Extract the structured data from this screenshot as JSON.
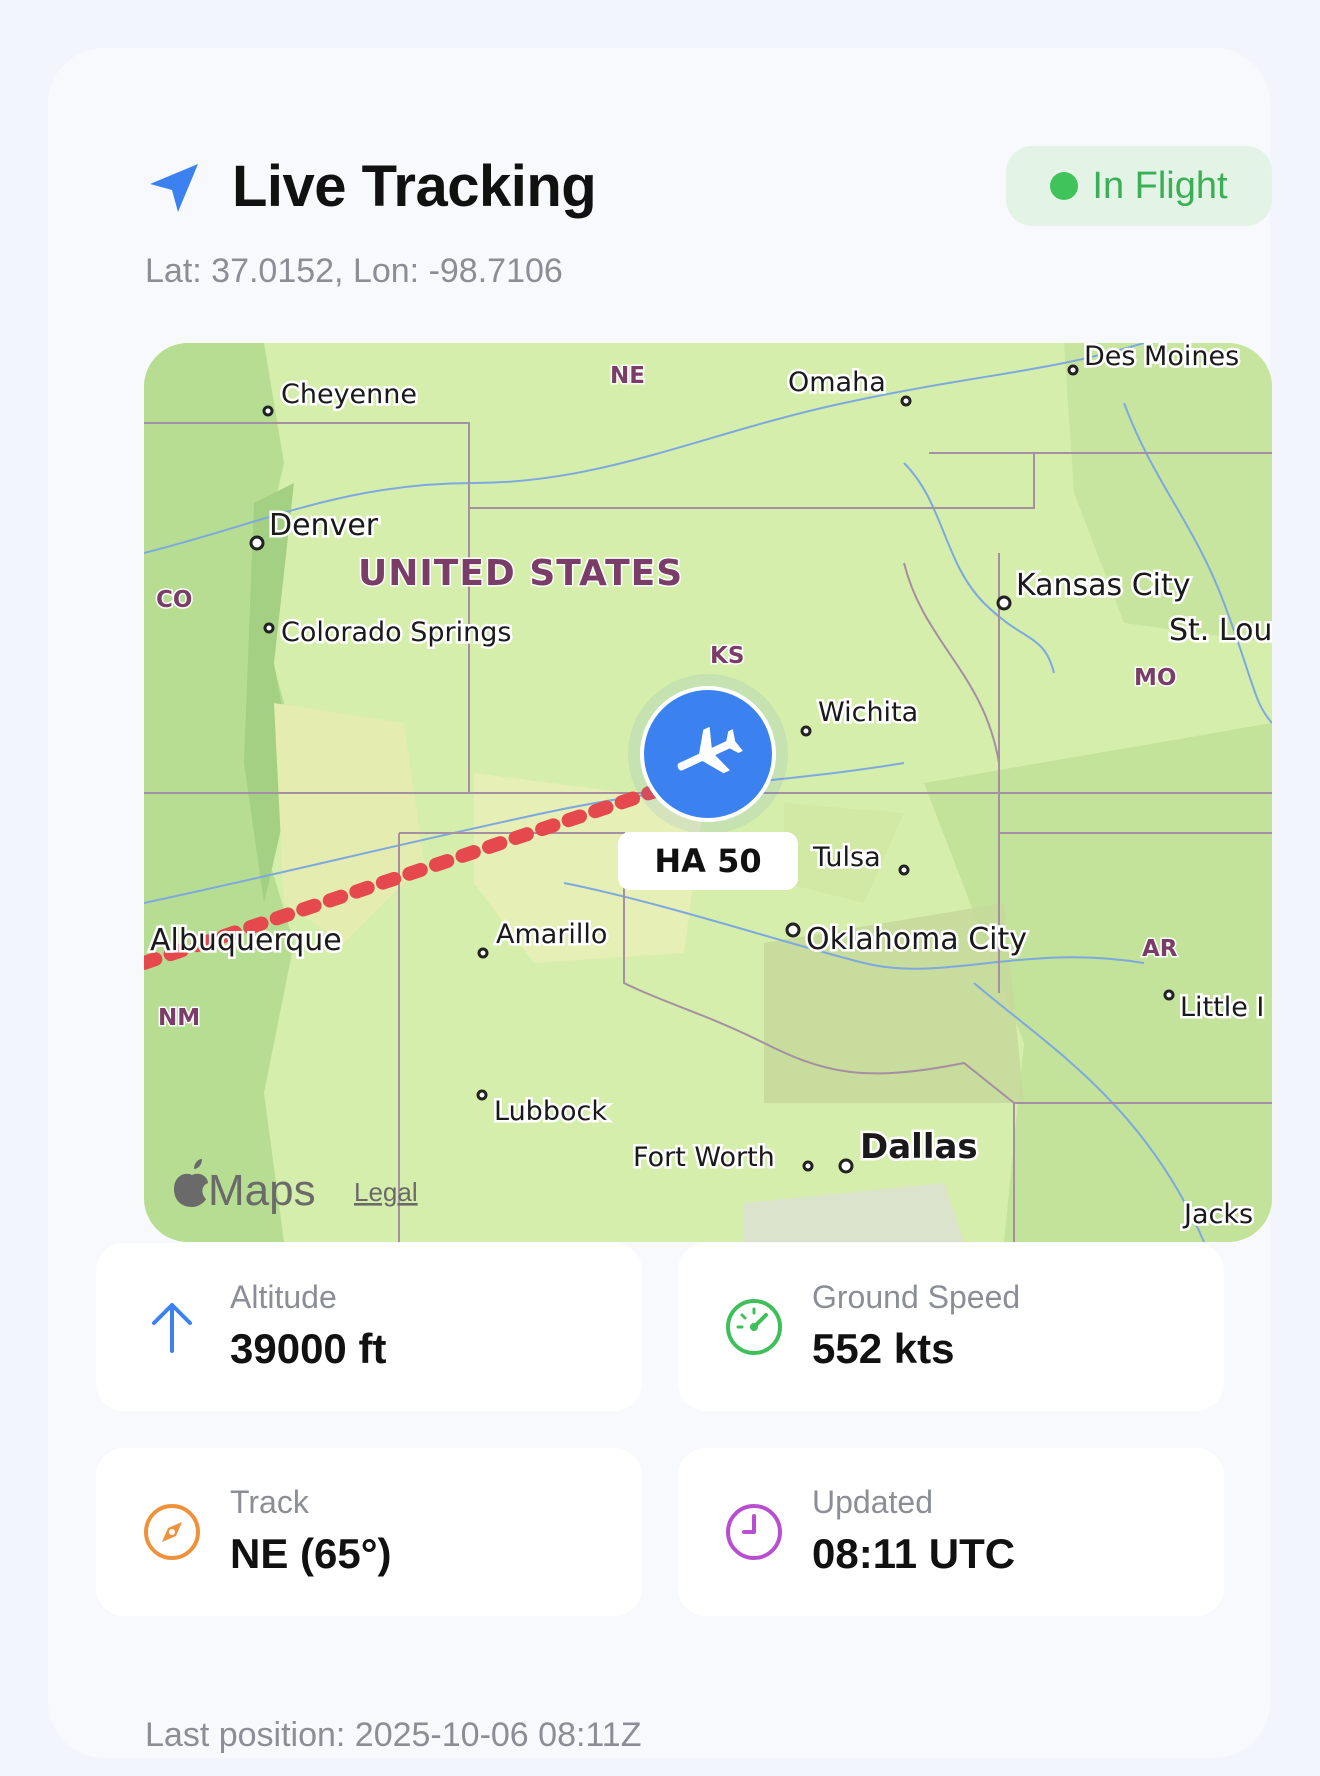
{
  "header": {
    "title": "Live Tracking",
    "icon": "navigation-arrow-icon",
    "status": "In Flight",
    "status_color": "#3fc35a",
    "coordinates": "Lat: 37.0152, Lon: -98.7106"
  },
  "map": {
    "flight_label": "HA 50",
    "cities": {
      "cheyenne": "Cheyenne",
      "denver": "Denver",
      "colorado_springs": "Colorado Springs",
      "omaha": "Omaha",
      "des_moines": "Des Moines",
      "kansas_city": "Kansas City",
      "st_louis": "St. Lou",
      "wichita": "Wichita",
      "tulsa": "Tulsa",
      "oklahoma_city": "Oklahoma City",
      "albuquerque": "Albuquerque",
      "amarillo": "Amarillo",
      "lubbock": "Lubbock",
      "fort_worth": "Fort Worth",
      "dallas": "Dallas",
      "little_rock": "Little I",
      "jackson": "Jacks"
    },
    "states": {
      "ne": "NE",
      "co": "CO",
      "ks": "KS",
      "mo": "MO",
      "ar": "AR",
      "nm": "NM"
    },
    "country": "UNITED STATES",
    "attribution": "Maps",
    "legal": "Legal",
    "route_color": "#e5484d",
    "marker_color": "#3b82f0"
  },
  "stats": {
    "altitude": {
      "label": "Altitude",
      "value": "39000 ft",
      "icon": "arrow-up-icon",
      "color": "#3b82f0"
    },
    "ground_speed": {
      "label": "Ground Speed",
      "value": "552 kts",
      "icon": "speedometer-icon",
      "color": "#3fbf5a"
    },
    "track": {
      "label": "Track",
      "value": "NE (65°)",
      "icon": "compass-icon",
      "color": "#f0923b"
    },
    "updated": {
      "label": "Updated",
      "value": "08:11 UTC",
      "icon": "clock-icon",
      "color": "#b84fd0"
    }
  },
  "footer": {
    "last_position": "Last position: 2025-10-06 08:11Z"
  }
}
